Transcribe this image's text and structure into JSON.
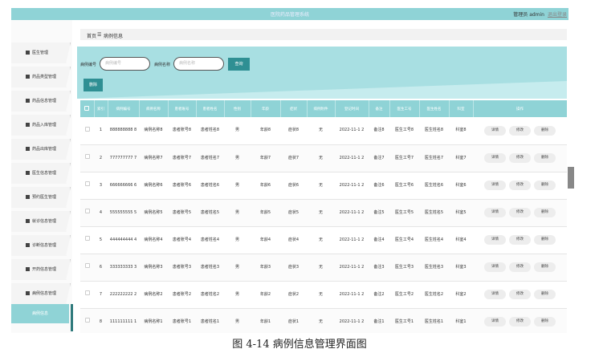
{
  "header": {
    "title": "医院药品管理系统",
    "admin": "管理员 admin",
    "logout": "退出登录"
  },
  "sidebar": {
    "items": [
      {
        "label": "医生管理",
        "icon": "doctor-icon"
      },
      {
        "label": "药品类型管理",
        "icon": "list-icon"
      },
      {
        "label": "药品信息管理",
        "icon": "trash-icon"
      },
      {
        "label": "药品入库管理",
        "icon": "warehouse-icon"
      },
      {
        "label": "药品出库管理",
        "icon": "grid-icon"
      },
      {
        "label": "医生信息管理",
        "icon": "grid-icon"
      },
      {
        "label": "预约医生管理",
        "icon": "grid-icon"
      },
      {
        "label": "就诊信息管理",
        "icon": "bulb-icon"
      },
      {
        "label": "诊断信息管理",
        "icon": "table-icon"
      },
      {
        "label": "开药信息管理",
        "icon": "bulb-icon"
      },
      {
        "label": "病例信息管理",
        "icon": "grid-icon"
      }
    ],
    "active": "病例信息"
  },
  "breadcrumb": {
    "home": "首页",
    "sep": "☰",
    "current": "病例信息"
  },
  "search": {
    "field1_label": "病例编号",
    "field1_placeholder": "病例编号",
    "field2_label": "病例名称",
    "field2_placeholder": "病例名称",
    "query": "查询",
    "delete": "删除"
  },
  "table": {
    "headers": [
      "",
      "索引",
      "病例编号",
      "病例名称",
      "患者账号",
      "患者姓名",
      "性别",
      "年龄",
      "症状",
      "病例附件",
      "登记时间",
      "备注",
      "医生工号",
      "医生姓名",
      "科室",
      "操作"
    ],
    "actions": [
      "详情",
      "修改",
      "删除"
    ],
    "rows": [
      [
        "1",
        "888888888 8",
        "病例名称8",
        "患者账号8",
        "患者姓名8",
        "男",
        "年龄8",
        "症状8",
        "无",
        "2022-11-1 2",
        "备注8",
        "医生工号8",
        "医生姓名8",
        "科室8"
      ],
      [
        "2",
        "777777777 7",
        "病例名称7",
        "患者账号7",
        "患者姓名7",
        "男",
        "年龄7",
        "症状7",
        "无",
        "2022-11-1 2",
        "备注7",
        "医生工号7",
        "医生姓名7",
        "科室7"
      ],
      [
        "3",
        "666666666 6",
        "病例名称6",
        "患者账号6",
        "患者姓名6",
        "男",
        "年龄6",
        "症状6",
        "无",
        "2022-11-1 2",
        "备注6",
        "医生工号6",
        "医生姓名6",
        "科室6"
      ],
      [
        "4",
        "555555555 5",
        "病例名称5",
        "患者账号5",
        "患者姓名5",
        "男",
        "年龄5",
        "症状5",
        "无",
        "2022-11-1 2",
        "备注5",
        "医生工号5",
        "医生姓名5",
        "科室5"
      ],
      [
        "5",
        "444444444 4",
        "病例名称4",
        "患者账号4",
        "患者姓名4",
        "男",
        "年龄4",
        "症状4",
        "无",
        "2022-11-1 2",
        "备注4",
        "医生工号4",
        "医生姓名4",
        "科室4"
      ],
      [
        "6",
        "333333333 3",
        "病例名称3",
        "患者账号3",
        "患者姓名3",
        "男",
        "年龄3",
        "症状3",
        "无",
        "2022-11-1 2",
        "备注3",
        "医生工号3",
        "医生姓名3",
        "科室3"
      ],
      [
        "7",
        "222222222 2",
        "病例名称2",
        "患者账号2",
        "患者姓名2",
        "男",
        "年龄2",
        "症状2",
        "无",
        "2022-11-1 2",
        "备注2",
        "医生工号2",
        "医生姓名2",
        "科室2"
      ],
      [
        "8",
        "111111111 1",
        "病例名称1",
        "患者账号1",
        "患者姓名1",
        "男",
        "年龄1",
        "症状1",
        "无",
        "2022-11-1 2",
        "备注1",
        "医生工号1",
        "医生姓名1",
        "科室1"
      ]
    ]
  },
  "caption": "图 4-14 病例信息管理界面图"
}
